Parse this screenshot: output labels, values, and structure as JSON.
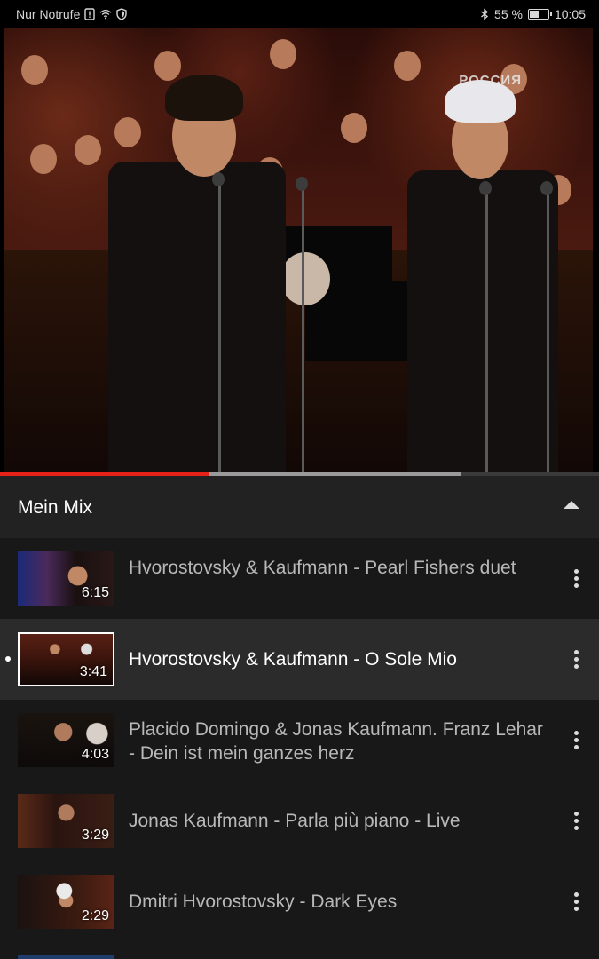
{
  "status_bar": {
    "carrier": "Nur Notrufe",
    "battery": "55 %",
    "battery_level": 0.55,
    "time": "10:05",
    "icons": [
      "sim-alert-icon",
      "wifi-icon",
      "shield-icon",
      "bluetooth-icon",
      "battery-icon"
    ]
  },
  "video": {
    "watermark": "РОССИЯ",
    "played_fraction": 0.35,
    "buffered_fraction": 0.77
  },
  "playlist": {
    "title": "Mein Mix",
    "items": [
      {
        "title": "Hvorostovsky & Kaufmann - Pearl Fishers duet",
        "duration": "6:15",
        "active": false
      },
      {
        "title": "Hvorostovsky & Kaufmann - O Sole Mio",
        "duration": "3:41",
        "active": true
      },
      {
        "title": "Placido Domingo & Jonas Kaufmann. Franz Lehar - Dein ist mein ganzes herz",
        "duration": "4:03",
        "active": false
      },
      {
        "title": "Jonas Kaufmann - Parla più piano - Live",
        "duration": "3:29",
        "active": false
      },
      {
        "title": "Dmitri Hvorostovsky - Dark Eyes",
        "duration": "2:29",
        "active": false
      }
    ]
  }
}
